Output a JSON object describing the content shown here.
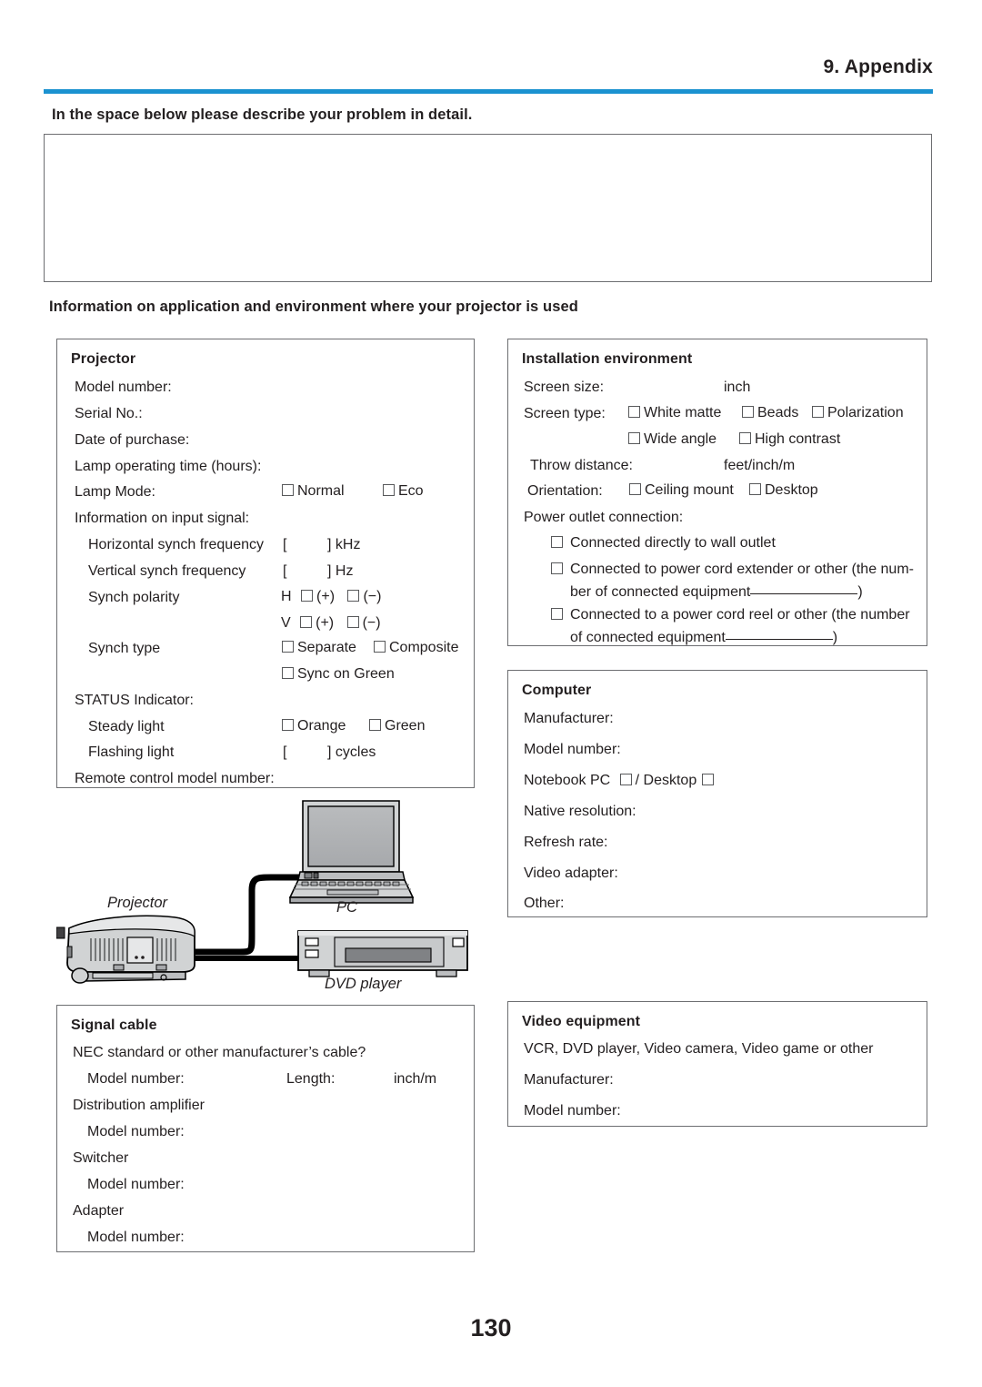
{
  "header": {
    "title": "9. Appendix",
    "rule_color": "#1b92d0"
  },
  "problem": {
    "heading": "In the space below please describe your problem in detail.",
    "textarea_value": ""
  },
  "info_heading": "Information on application and environment where your projector is used",
  "projector": {
    "title": "Projector",
    "model_number": "Model number:",
    "serial_no": "Serial No.:",
    "date_of_purchase": "Date of purchase:",
    "lamp_operating_time": "Lamp operating time (hours):",
    "lamp_mode_label": "Lamp Mode:",
    "lamp_mode_opt1": "Normal",
    "lamp_mode_opt2": "Eco",
    "input_signal_label": "Information on input signal:",
    "h_synch_label": "Horizontal synch frequency",
    "h_synch_value": "[",
    "h_synch_unit": "] kHz",
    "v_synch_label": "Vertical synch frequency",
    "v_synch_value": "[",
    "v_synch_unit": "] Hz",
    "synch_polarity_label": "Synch polarity",
    "polarity_h_prefix": "H",
    "polarity_h_plus": "(+)",
    "polarity_h_minus": "(−)",
    "polarity_v_prefix": "V",
    "polarity_v_plus": "(+)",
    "polarity_v_minus": "(−)",
    "synch_type_label": "Synch type",
    "synch_type_opt1": "Separate",
    "synch_type_opt2": "Composite",
    "synch_type_opt3": "Sync on Green",
    "status_indicator_label": "STATUS Indicator:",
    "steady_light_label": "Steady light",
    "steady_opt1": "Orange",
    "steady_opt2": "Green",
    "flashing_light_label": "Flashing light",
    "flashing_value": "[",
    "flashing_unit": "] cycles",
    "remote_control": "Remote control model number:"
  },
  "installation": {
    "title": "Installation environment",
    "screen_size_label": "Screen size:",
    "screen_size_unit": "inch",
    "screen_type_label": "Screen type:",
    "screen_type_opt1": "White matte",
    "screen_type_opt2": "Beads",
    "screen_type_opt3": "Polarization",
    "screen_type_opt4": "Wide angle",
    "screen_type_opt5": "High contrast",
    "throw_distance_label": "Throw distance:",
    "throw_distance_unit": "feet/inch/m",
    "orientation_label": "Orientation:",
    "orientation_opt1": "Ceiling mount",
    "orientation_opt2": "Desktop",
    "power_outlet_label": "Power outlet connection:",
    "power_opt1": "Connected directly to wall outlet",
    "power_opt2_line1": "Connected to power cord extender or other (the num-",
    "power_opt2_line2": "ber of connected equipment",
    "power_opt2_close": ")",
    "power_opt3_line1": "Connected to a power cord reel or other (the number",
    "power_opt3_line2": "of connected equipment",
    "power_opt3_close": ")"
  },
  "computer": {
    "title": "Computer",
    "manufacturer": "Manufacturer:",
    "model_number": "Model number:",
    "notebook_label": "Notebook PC",
    "notebook_sep": "/ Desktop",
    "native_resolution": "Native resolution:",
    "refresh_rate": "Refresh rate:",
    "video_adapter": "Video adapter:",
    "other": "Other:"
  },
  "diagram": {
    "projector_label": "Projector",
    "pc_label": "PC",
    "dvd_label": "DVD player"
  },
  "signal_cable": {
    "title": "Signal cable",
    "nec_question": "NEC standard or other manufacturer’s cable?",
    "model_number_1": "Model number:",
    "length_label": "Length:",
    "length_unit": "inch/m",
    "distribution_amplifier": "Distribution amplifier",
    "model_number_2": "Model number:",
    "switcher": "Switcher",
    "model_number_3": "Model number:",
    "adapter": "Adapter",
    "model_number_4": "Model number:"
  },
  "video_equipment": {
    "title": "Video equipment",
    "devices": "VCR, DVD player, Video camera, Video game or other",
    "manufacturer": "Manufacturer:",
    "model_number": "Model number:"
  },
  "page_number": "130"
}
